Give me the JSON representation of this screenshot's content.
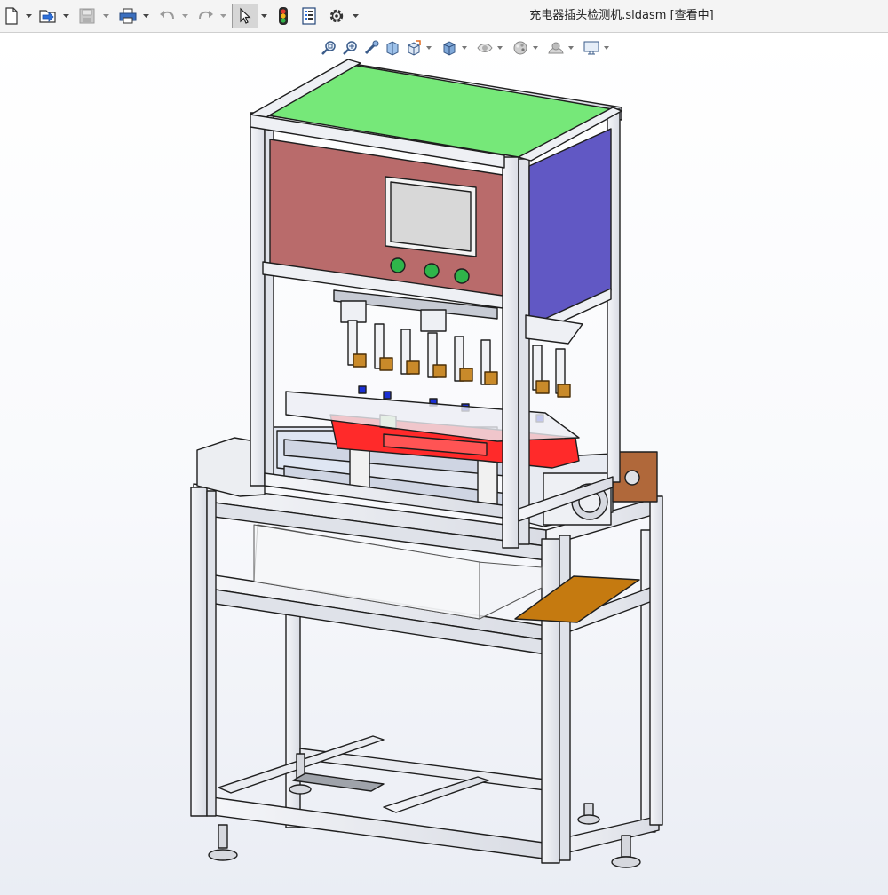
{
  "window": {
    "title": "充电器插头检测机.sldasm [查看中]"
  },
  "toolbar": {
    "items": [
      {
        "name": "new-document",
        "icon": "new-document-icon",
        "has_dropdown": true
      },
      {
        "name": "open",
        "icon": "open-folder-icon",
        "has_dropdown": true
      },
      {
        "name": "save",
        "icon": "save-icon",
        "has_dropdown": true,
        "disabled": true
      },
      {
        "name": "print",
        "icon": "print-icon",
        "has_dropdown": true
      },
      {
        "name": "undo",
        "icon": "undo-icon",
        "has_dropdown": true,
        "disabled": true
      },
      {
        "name": "redo",
        "icon": "redo-icon",
        "has_dropdown": true,
        "disabled": true
      },
      {
        "name": "select",
        "icon": "select-arrow-icon",
        "has_dropdown": true,
        "selected": true
      },
      {
        "name": "rebuild",
        "icon": "traffic-light-icon",
        "has_dropdown": false
      },
      {
        "name": "file-properties",
        "icon": "file-properties-icon",
        "has_dropdown": false
      },
      {
        "name": "options",
        "icon": "gear-icon",
        "has_dropdown": true
      }
    ]
  },
  "heads_up_toolbar": {
    "items": [
      {
        "name": "zoom-to-fit",
        "icon": "zoom-to-fit-icon"
      },
      {
        "name": "zoom-to-area",
        "icon": "zoom-to-area-icon"
      },
      {
        "name": "previous-view",
        "icon": "previous-view-icon"
      },
      {
        "name": "section-view",
        "icon": "section-view-icon"
      },
      {
        "name": "view-orientation",
        "icon": "view-orientation-icon",
        "has_dropdown": true
      },
      {
        "name": "display-style",
        "icon": "display-style-cube-icon",
        "has_dropdown": true
      },
      {
        "name": "hide-show-items",
        "icon": "hide-show-eye-icon",
        "has_dropdown": true
      },
      {
        "name": "edit-appearance",
        "icon": "edit-appearance-icon",
        "has_dropdown": true
      },
      {
        "name": "apply-scene",
        "icon": "apply-scene-icon",
        "has_dropdown": true
      },
      {
        "name": "view-settings",
        "icon": "monitor-icon",
        "has_dropdown": true
      }
    ]
  },
  "model": {
    "name": "charger-plug-inspection-machine",
    "colors": {
      "frame": "#eef0f4",
      "frame_edge": "#1e1e1e",
      "top_panel": "#76e879",
      "front_panel": "#b96b6b",
      "side_panel": "#6158c4",
      "screen": "#d8d8d8",
      "buttons": "#2fb54a",
      "fixture": "#ff2a2a",
      "tray": "#c57a10",
      "mount_plate": "#b0683a"
    }
  }
}
